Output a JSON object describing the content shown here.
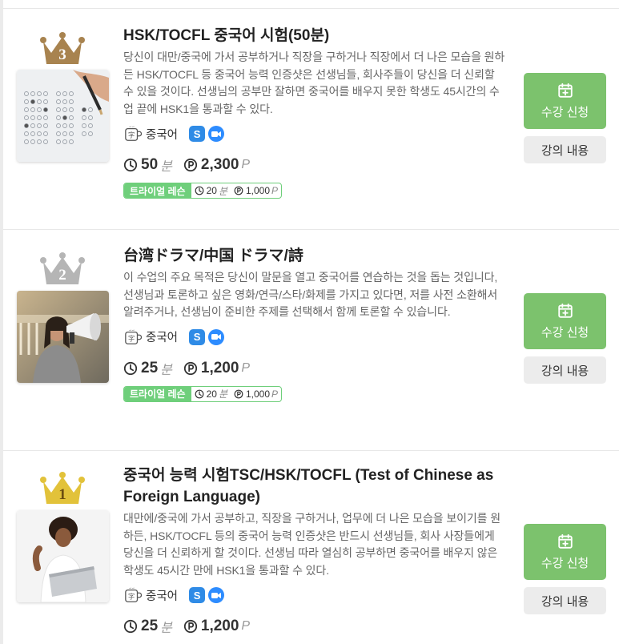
{
  "buttons": {
    "enroll_label": "수강 신청",
    "detail_label": "강의 내용"
  },
  "trial_tag": "트라이얼 레슨",
  "colors": {
    "accent_green": "#7cc26d",
    "trial_green": "#6fcf7b",
    "gold": "#d8b429",
    "silver": "#b5b5b5",
    "bronze": "#a8834f"
  },
  "courses": [
    {
      "rank": "3",
      "rank_medal": "bronze",
      "title": "HSK/TOCFL 중국어 시험(50분)",
      "description": "당신이 대만/중국에 가서 공부하거나 직장을 구하거나 직장에서 더 나은 모습을 원하든 HSK/TOCFL 등 중국어 능력 인증샷은 선생님들, 회사주들이 당신을 더 신뢰할 수 있을 것이다. 선생님의 공부만 잘하면 중국어를 배우지 못한 학생도 45시간의 수업 끝에 HSK1을 통과할 수 있다.",
      "language": "중국어",
      "duration": "50",
      "duration_unit": "분",
      "price": "2,300",
      "price_unit": "P",
      "trial_duration": "20",
      "trial_price": "1,000",
      "photo": "exam-sheet-photo"
    },
    {
      "rank": "2",
      "rank_medal": "silver",
      "title": "台湾ドラマ/中国 ドラマ/詩",
      "description": "이 수업의 주요 목적은 당신이 말문을 열고 중국어를 연습하는 것을 돕는 것입니다, 선생님과 토론하고 싶은 영화/연극/스타/화제를 가지고 있다면, 저를 사전 소환해서 알려주거나, 선생님이 준비한 주제를 선택해서 함께 토론할 수 있습니다.",
      "language": "중국어",
      "duration": "25",
      "duration_unit": "분",
      "price": "1,200",
      "price_unit": "P",
      "trial_duration": "20",
      "trial_price": "1,000",
      "photo": "megaphone-photo"
    },
    {
      "rank": "1",
      "rank_medal": "gold",
      "title": "중국어 능력 시험TSC/HSK/TOCFL (Test of Chinese as Foreign Language)",
      "description": "대만에/중국에 가서 공부하고, 직장을 구하거나, 업무에 더 나은 모습을 보이기를 원하든, HSK/TOCFL 등의 중국어 능력 인증샷은 반드시 선생님들, 회사 사장들에게 당신을 더 신뢰하게 할 것이다. 선생님 따라 열심히 공부하면 중국어를 배우지 않은 학생도 45시간 만에 HSK1을 통과할 수 있다.",
      "language": "중국어",
      "duration": "25",
      "duration_unit": "분",
      "price": "1,200",
      "price_unit": "P",
      "photo": "laptop-photo"
    }
  ]
}
